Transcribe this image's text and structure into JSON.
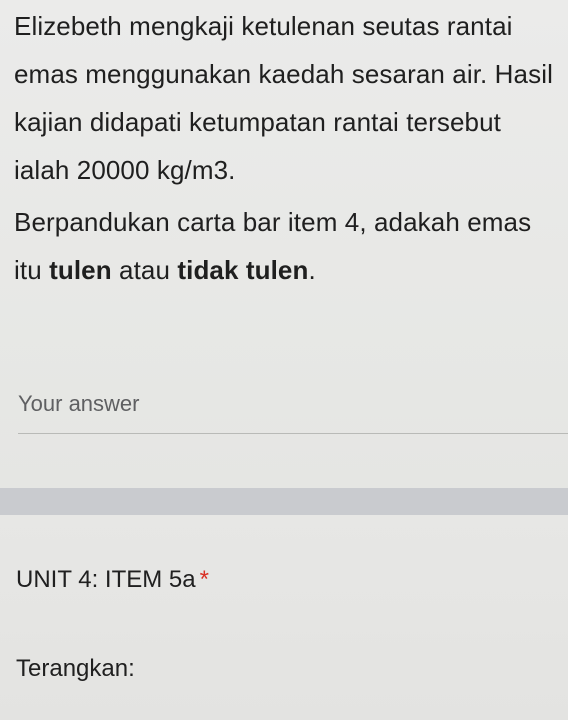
{
  "question": {
    "line1_pre": "Elizebeth mengkaji ketulenan seutas rantai emas menggunakan kaedah sesaran air. Hasil kajian didapati ketumpatan rantai tersebut ialah 20000 kg/m3.",
    "line2_pre": "Berpandukan carta bar item 4, adakah emas itu ",
    "line2_bold1": "tulen",
    "line2_mid": " atau ",
    "line2_bold2": "tidak tulen",
    "line2_post": "."
  },
  "answer": {
    "placeholder": "Your answer",
    "value": ""
  },
  "next_item": {
    "title": "UNIT 4: ITEM 5a",
    "required_marker": "*",
    "prompt": "Terangkan:"
  }
}
